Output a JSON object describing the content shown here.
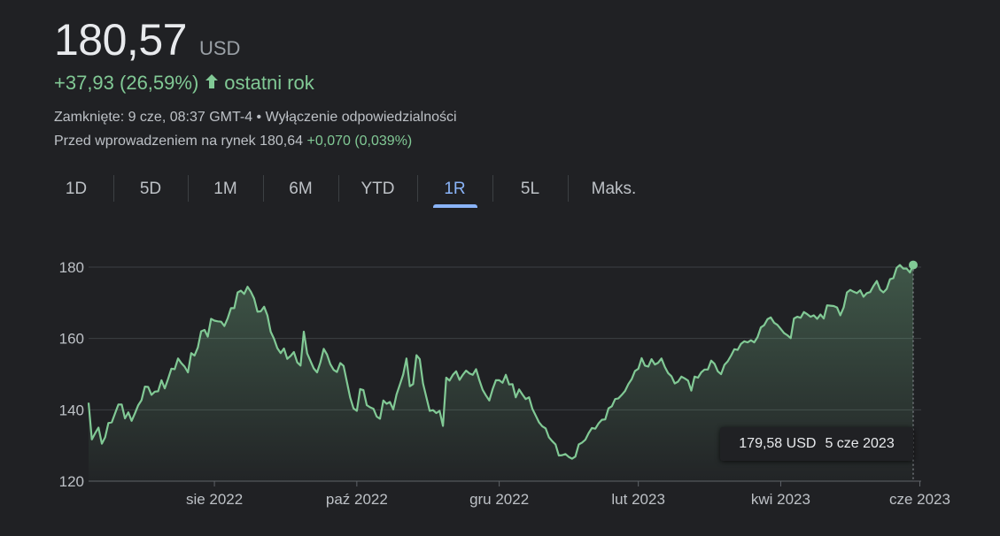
{
  "header": {
    "price": "180,57",
    "currency": "USD",
    "change": "+37,93 (26,59%)",
    "change_period": "ostatni rok",
    "closed_info": "Zamknięte: 9 cze, 08:37 GMT-4 • Wyłączenie odpowiedzialności",
    "premarket_label": "Przed wprowadzeniem na rynek 180,64",
    "premarket_change": "+0,070 (0,039%)"
  },
  "tabs": [
    {
      "label": "1D",
      "active": false
    },
    {
      "label": "5D",
      "active": false
    },
    {
      "label": "1M",
      "active": false
    },
    {
      "label": "6M",
      "active": false
    },
    {
      "label": "YTD",
      "active": false
    },
    {
      "label": "1R",
      "active": true
    },
    {
      "label": "5L",
      "active": false
    },
    {
      "label": "Maks.",
      "active": false
    }
  ],
  "tooltip": {
    "value": "179,58 USD",
    "date": "5 cze 2023"
  },
  "colors": {
    "line": "#81c995",
    "accent": "#8ab4f8",
    "grid": "#3c4043",
    "background": "#202124"
  },
  "chart_data": {
    "type": "area",
    "ylim": [
      120,
      180
    ],
    "yticks": [
      180,
      160,
      140,
      120
    ],
    "xtick_labels": [
      "sie 2022",
      "paź 2022",
      "gru 2022",
      "lut 2023",
      "kwi 2023",
      "cze 2023"
    ],
    "xtick_positions": [
      38,
      81,
      124,
      166,
      209,
      251
    ],
    "cursor_index": 249,
    "values": [
      142.0,
      131.7,
      133.5,
      135.0,
      130.5,
      132.3,
      136.3,
      136.5,
      139.0,
      141.5,
      141.5,
      137.6,
      139.3,
      136.9,
      139.0,
      141.3,
      142.7,
      146.5,
      146.4,
      144.2,
      145.1,
      145.2,
      148.3,
      146.0,
      148.6,
      151.5,
      151.4,
      154.4,
      153.1,
      152.1,
      150.5,
      155.9,
      155.2,
      157.5,
      162.0,
      162.4,
      160.5,
      165.5,
      165.0,
      164.8,
      164.7,
      163.5,
      165.6,
      168.5,
      168.5,
      172.9,
      173.4,
      172.5,
      174.5,
      173.1,
      171.2,
      167.5,
      167.6,
      168.9,
      166.5,
      161.9,
      159.9,
      157.3,
      155.9,
      157.2,
      154.3,
      155.1,
      156.2,
      153.3,
      152.4,
      161.9,
      155.8,
      153.7,
      151.6,
      150.5,
      153.3,
      157.1,
      155.5,
      152.8,
      151.2,
      150.6,
      153.1,
      152.3,
      147.9,
      143.4,
      140.4,
      139.7,
      145.8,
      145.5,
      141.3,
      140.7,
      140.3,
      138.1,
      137.5,
      142.6,
      141.7,
      142.2,
      140.1,
      144.3,
      147.1,
      149.9,
      154.4,
      146.6,
      147.2,
      155.3,
      154.2,
      147.4,
      143.5,
      139.7,
      139.9,
      139.1,
      139.7,
      135.5,
      149.0,
      148.2,
      149.8,
      150.8,
      148.4,
      149.8,
      151.0,
      150.2,
      149.8,
      151.4,
      148.3,
      145.6,
      144.0,
      142.6,
      145.8,
      148.3,
      148.3,
      147.6,
      149.8,
      147.1,
      147.2,
      143.5,
      145.7,
      144.3,
      143.0,
      143.5,
      140.3,
      138.4,
      136.5,
      135.4,
      134.8,
      132.3,
      131.2,
      130.3,
      127.2,
      127.3,
      127.6,
      126.8,
      126.3,
      126.9,
      130.3,
      130.8,
      131.6,
      133.5,
      134.9,
      134.7,
      136.2,
      137.2,
      137.3,
      140.4,
      141.0,
      143.0,
      143.2,
      144.2,
      145.3,
      147.2,
      148.6,
      150.9,
      151.5,
      154.5,
      152.4,
      152.1,
      154.2,
      152.7,
      153.2,
      154.4,
      152.0,
      150.3,
      149.4,
      147.4,
      147.9,
      149.3,
      148.8,
      148.2,
      145.4,
      149.3,
      149.0,
      150.5,
      151.3,
      151.3,
      153.8,
      152.9,
      150.8,
      150.0,
      152.6,
      153.6,
      155.2,
      157.0,
      156.8,
      158.5,
      159.2,
      158.9,
      159.5,
      158.9,
      160.4,
      163.1,
      163.7,
      165.4,
      165.9,
      164.4,
      163.8,
      162.7,
      161.5,
      160.9,
      160.1,
      165.6,
      166.1,
      165.8,
      167.4,
      166.8,
      166.1,
      166.5,
      165.5,
      166.7,
      165.6,
      169.3,
      169.2,
      169.1,
      168.7,
      166.5,
      168.7,
      172.9,
      173.6,
      173.1,
      172.7,
      173.5,
      171.7,
      172.7,
      173.0,
      174.7,
      176.1,
      173.7,
      172.9,
      173.9,
      176.6,
      176.9,
      179.8,
      180.6,
      179.6,
      179.6,
      178.5,
      180.6
    ]
  }
}
